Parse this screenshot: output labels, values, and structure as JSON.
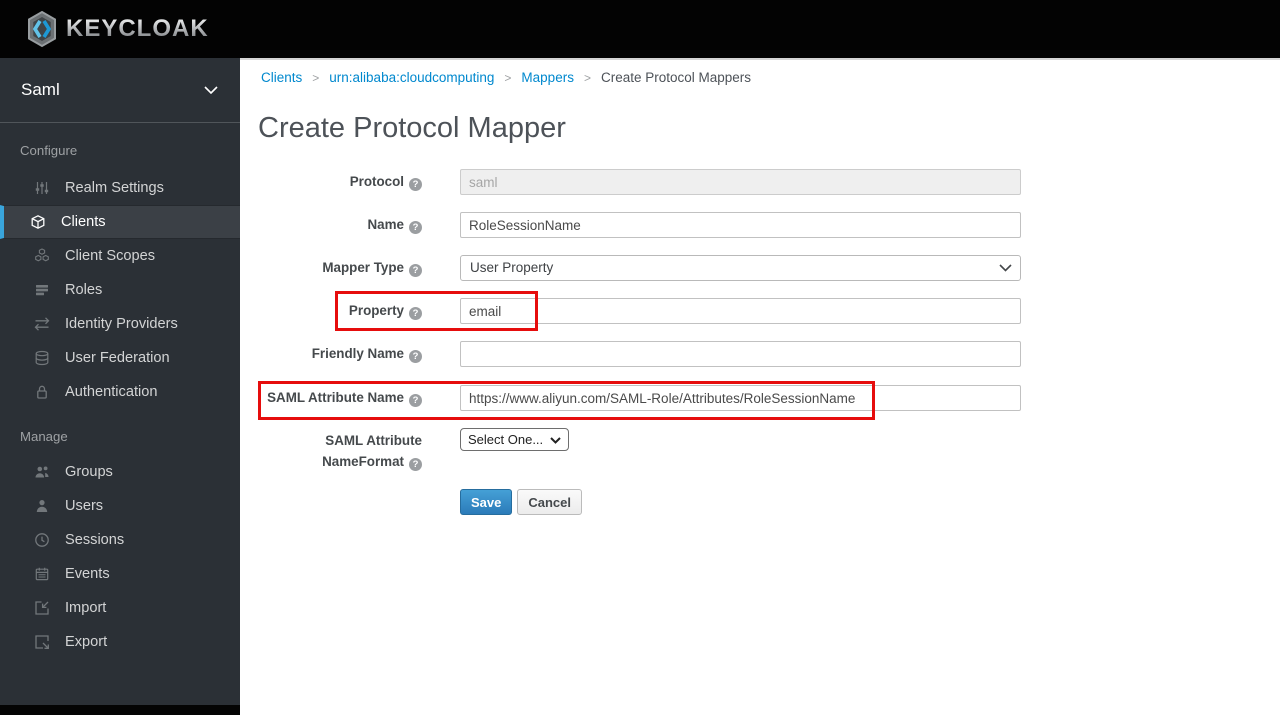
{
  "header": {
    "logo_text": "KEYCLOAK"
  },
  "sidebar": {
    "realm_name": "Saml",
    "sections": [
      {
        "label": "Configure",
        "items": [
          {
            "label": "Realm Settings",
            "icon": "sliders-icon",
            "selected": false
          },
          {
            "label": "Clients",
            "icon": "cube-icon",
            "selected": true
          },
          {
            "label": "Client Scopes",
            "icon": "cubes-icon",
            "selected": false
          },
          {
            "label": "Roles",
            "icon": "list-icon",
            "selected": false
          },
          {
            "label": "Identity Providers",
            "icon": "exchange-arrows-icon",
            "selected": false
          },
          {
            "label": "User Federation",
            "icon": "database-icon",
            "selected": false
          },
          {
            "label": "Authentication",
            "icon": "lock-icon",
            "selected": false
          }
        ]
      },
      {
        "label": "Manage",
        "items": [
          {
            "label": "Groups",
            "icon": "users-icon",
            "selected": false
          },
          {
            "label": "Users",
            "icon": "user-icon",
            "selected": false
          },
          {
            "label": "Sessions",
            "icon": "clock-icon",
            "selected": false
          },
          {
            "label": "Events",
            "icon": "calendar-icon",
            "selected": false
          },
          {
            "label": "Import",
            "icon": "import-icon",
            "selected": false
          },
          {
            "label": "Export",
            "icon": "export-icon",
            "selected": false
          }
        ]
      }
    ]
  },
  "breadcrumb": {
    "items": [
      {
        "label": "Clients",
        "link": true
      },
      {
        "label": "urn:alibaba:cloudcomputing",
        "link": true
      },
      {
        "label": "Mappers",
        "link": true
      },
      {
        "label": "Create Protocol Mappers",
        "link": false
      }
    ]
  },
  "main": {
    "title": "Create Protocol Mapper",
    "form": {
      "fields": [
        {
          "label": "Protocol",
          "control": "text",
          "value": "saml",
          "disabled": true
        },
        {
          "label": "Name",
          "control": "text",
          "value": "RoleSessionName",
          "disabled": false
        },
        {
          "label": "Mapper Type",
          "control": "select",
          "value": "User Property"
        },
        {
          "label": "Property",
          "control": "text",
          "value": "email",
          "disabled": false
        },
        {
          "label": "Friendly Name",
          "control": "text",
          "value": "",
          "disabled": false
        },
        {
          "label": "SAML Attribute Name",
          "control": "text",
          "value": "https://www.aliyun.com/SAML-Role/Attributes/RoleSessionName",
          "disabled": false
        },
        {
          "label": "SAML Attribute NameFormat",
          "control": "select",
          "value": "Select One..."
        }
      ],
      "buttons": {
        "save": "Save",
        "cancel": "Cancel"
      }
    }
  },
  "annotations": {
    "highlight_color": "#e60d0d",
    "boxes": [
      {
        "target": "property-field"
      },
      {
        "target": "saml-attribute-name-field"
      }
    ]
  },
  "colors": {
    "accent_blue": "#39a5dc",
    "link_blue": "#0088ce",
    "save_button_blue": "#2b7bb9",
    "sidebar_bg": "#2b3036",
    "topbar_bg": "#030303"
  }
}
